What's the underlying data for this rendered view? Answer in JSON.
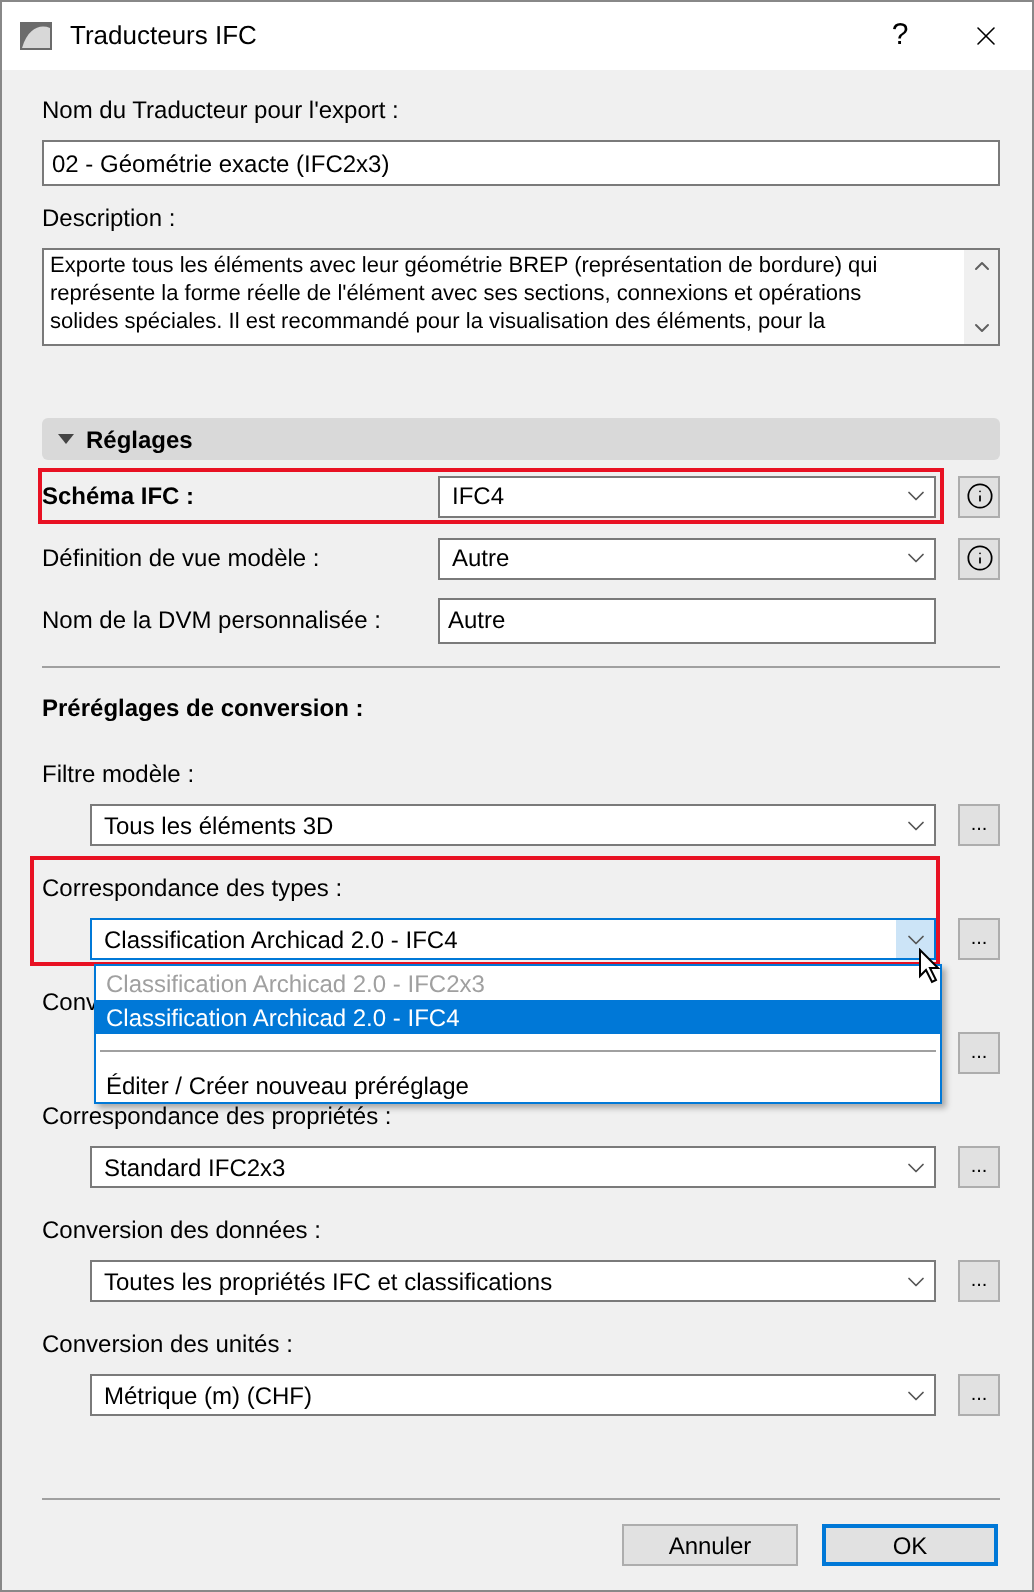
{
  "window": {
    "title": "Traducteurs IFC",
    "help": "?"
  },
  "name_field": {
    "label": "Nom du Traducteur pour l'export :",
    "value": "02 - Géométrie exacte (IFC2x3)"
  },
  "description": {
    "label": "Description :",
    "lines": [
      "Exporte tous les éléments avec leur géométrie BREP (représentation de bordure) qui",
      "représente la forme réelle de l'élément avec ses sections, connexions et opérations",
      "solides spéciales. Il est recommandé pour la visualisation des éléments, pour la"
    ]
  },
  "settings": {
    "title": "Réglages",
    "expanded": true,
    "rows": [
      {
        "kind": "select",
        "label": "Schéma IFC :",
        "value": "IFC4",
        "emphasized": true,
        "highlighted": true,
        "info": true
      },
      {
        "kind": "select",
        "label": "Définition de vue modèle :",
        "value": "Autre",
        "emphasized": false,
        "highlighted": false,
        "info": true
      },
      {
        "kind": "text",
        "label": "Nom de la DVM personnalisée :",
        "value": "Autre",
        "emphasized": false,
        "highlighted": false,
        "info": false
      }
    ]
  },
  "presets": {
    "title": "Préréglages de conversion :",
    "rows": [
      {
        "label": "Filtre modèle :",
        "value": "Tous les éléments 3D",
        "highlighted": false,
        "covered": false,
        "open": false
      },
      {
        "label": "Correspondance des types :",
        "value": "Classification Archicad 2.0 - IFC4",
        "highlighted": true,
        "covered": false,
        "open": true,
        "options": [
          {
            "kind": "option",
            "label": "Classification Archicad 2.0 - IFC2x3",
            "disabled": true,
            "selected": false
          },
          {
            "kind": "option",
            "label": "Classification Archicad 2.0 - IFC4",
            "disabled": false,
            "selected": true
          },
          {
            "kind": "separator"
          },
          {
            "kind": "option",
            "label": "Éditer / Créer nouveau préréglage",
            "disabled": false,
            "selected": false
          }
        ]
      },
      {
        "label": "Conv",
        "covered": true,
        "highlighted": false,
        "open": false
      },
      {
        "label": "Correspondance des propriétés :",
        "value": "Standard IFC2x3",
        "highlighted": false,
        "covered": false,
        "open": false
      },
      {
        "label": "Conversion des données :",
        "value": "Toutes les propriétés IFC et classifications",
        "highlighted": false,
        "covered": false,
        "open": false
      },
      {
        "label": "Conversion des unités :",
        "value": "Métrique (m) (CHF)",
        "highlighted": false,
        "covered": false,
        "open": false
      }
    ]
  },
  "more_button": "...",
  "buttons": [
    {
      "label": "Annuler",
      "default": false
    },
    {
      "label": "OK",
      "default": true
    }
  ]
}
